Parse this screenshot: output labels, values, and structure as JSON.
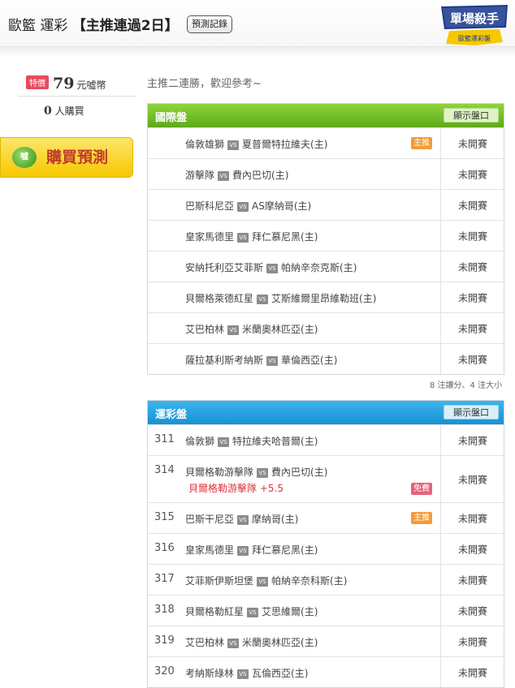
{
  "header": {
    "title_prefix": "歐籃 運彩",
    "title_main": "【主推連過2日】",
    "record_button": "預測記錄",
    "badge_line1": "單場殺手",
    "badge_line2": "歐籃運彩盤"
  },
  "sidebar": {
    "price_tag": "特價",
    "price_value": "79",
    "price_unit": "元噓幣",
    "buyers_count": "0",
    "buyers_label": "人購買",
    "buy_icon_text": "噓",
    "buy_button": "購買預測"
  },
  "notice": "主推二連勝，歡迎參考~",
  "intl_panel": {
    "title": "國際盤",
    "show_odds": "顯示盤口",
    "rows": [
      {
        "home": "倫敦雄獅",
        "away": "夏普爾特拉維夫(主)",
        "tag": "主推",
        "status": "未開賽"
      },
      {
        "home": "游擊隊",
        "away": "費內巴切(主)",
        "tag": "",
        "status": "未開賽"
      },
      {
        "home": "巴斯科尼亞",
        "away": "AS摩納哥(主)",
        "tag": "",
        "status": "未開賽"
      },
      {
        "home": "皇家馬德里",
        "away": "拜仁慕尼黑(主)",
        "tag": "",
        "status": "未開賽"
      },
      {
        "home": "安納托利亞艾菲斯",
        "away": "帕納辛奈克斯(主)",
        "tag": "",
        "status": "未開賽"
      },
      {
        "home": "貝爾格萊德紅星",
        "away": "艾斯維爾里昂維勒班(主)",
        "tag": "",
        "status": "未開賽"
      },
      {
        "home": "艾巴柏林",
        "away": "米蘭奧林匹亞(主)",
        "tag": "",
        "status": "未開賽"
      },
      {
        "home": "薩拉基利斯考納斯",
        "away": "華倫西亞(主)",
        "tag": "",
        "status": "未開賽"
      }
    ],
    "footer": "8 注讓分、4 注大小"
  },
  "sports_panel": {
    "title": "運彩盤",
    "show_odds": "顯示盤口",
    "rows": [
      {
        "no": "311",
        "home": "倫敦獅",
        "away": "特拉維夫哈普爾(主)",
        "tag": "",
        "pick": "",
        "free": "",
        "status": "未開賽"
      },
      {
        "no": "314",
        "home": "貝爾格勒游擊隊",
        "away": "費內巴切(主)",
        "tag": "",
        "pick": "貝爾格勒游擊隊 +5.5",
        "free": "免費",
        "status": "未開賽"
      },
      {
        "no": "315",
        "home": "巴斯干尼亞",
        "away": "摩納哥(主)",
        "tag": "主推",
        "pick": "",
        "free": "",
        "status": "未開賽"
      },
      {
        "no": "316",
        "home": "皇家馬德里",
        "away": "拜仁慕尼黑(主)",
        "tag": "",
        "pick": "",
        "free": "",
        "status": "未開賽"
      },
      {
        "no": "317",
        "home": "艾菲斯伊斯坦堡",
        "away": "帕納辛奈科斯(主)",
        "tag": "",
        "pick": "",
        "free": "",
        "status": "未開賽"
      },
      {
        "no": "318",
        "home": "貝爾格勒紅星",
        "away": "艾思維爾(主)",
        "tag": "",
        "pick": "",
        "free": "",
        "status": "未開賽"
      },
      {
        "no": "319",
        "home": "艾巴柏林",
        "away": "米蘭奧林匹亞(主)",
        "tag": "",
        "pick": "",
        "free": "",
        "status": "未開賽"
      },
      {
        "no": "320",
        "home": "考納斯綠林",
        "away": "瓦倫西亞(主)",
        "tag": "",
        "pick": "",
        "free": "",
        "status": "未開賽"
      }
    ]
  },
  "vs_label": "VS"
}
